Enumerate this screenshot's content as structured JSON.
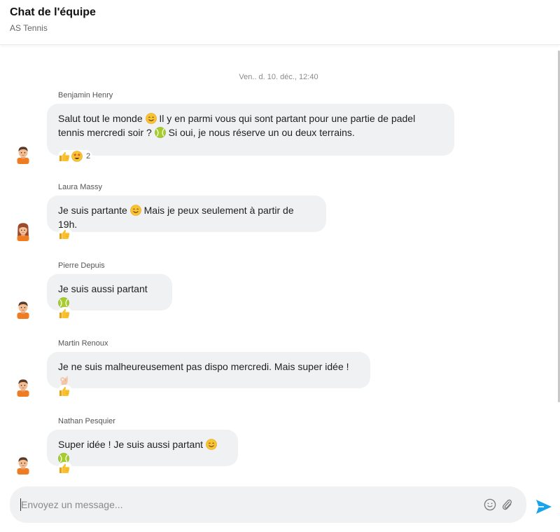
{
  "header": {
    "title": "Chat de l'équipe",
    "subtitle": "AS Tennis"
  },
  "feed": {
    "date_separator": "Ven.. d. 10. déc., 12:40"
  },
  "messages": [
    {
      "sender": "Benjamin Henry",
      "line1": "Salut tout le monde",
      "line1b": "Il y en parmi vous qui sont partant pour une partie de padel",
      "line2": "tennis mercredi soir ?",
      "line2b": "Si oui, je nous réserve un ou deux terrains.",
      "reaction_count": "2"
    },
    {
      "sender": "Laura Massy",
      "text_a": "Je suis partante",
      "text_b": "Mais je peux seulement à partir de 19h."
    },
    {
      "sender": "Pierre Depuis",
      "text_a": "Je suis aussi partant"
    },
    {
      "sender": "Martin Renoux",
      "text_a": "Je ne suis malheureusement pas dispo mercredi. Mais super idée !"
    },
    {
      "sender": "Nathan Pesquier",
      "text_a": "Super idée ! Je suis aussi partant"
    }
  ],
  "icons": {
    "smile_emoji": "smiling-face-emoji",
    "tennis_emoji": "tennis-ball-emoji",
    "thumbs_up": "thumbs-up-emoji",
    "star_struck": "star-struck-emoji",
    "ok_hand": "ok-hand-emoji",
    "send": "send-icon"
  },
  "composer": {
    "placeholder": "Envoyez un message..."
  },
  "colors": {
    "bubble": "#f0f1f3",
    "accent": "#1aa3e8",
    "avatar_orange": "#f07c22"
  }
}
